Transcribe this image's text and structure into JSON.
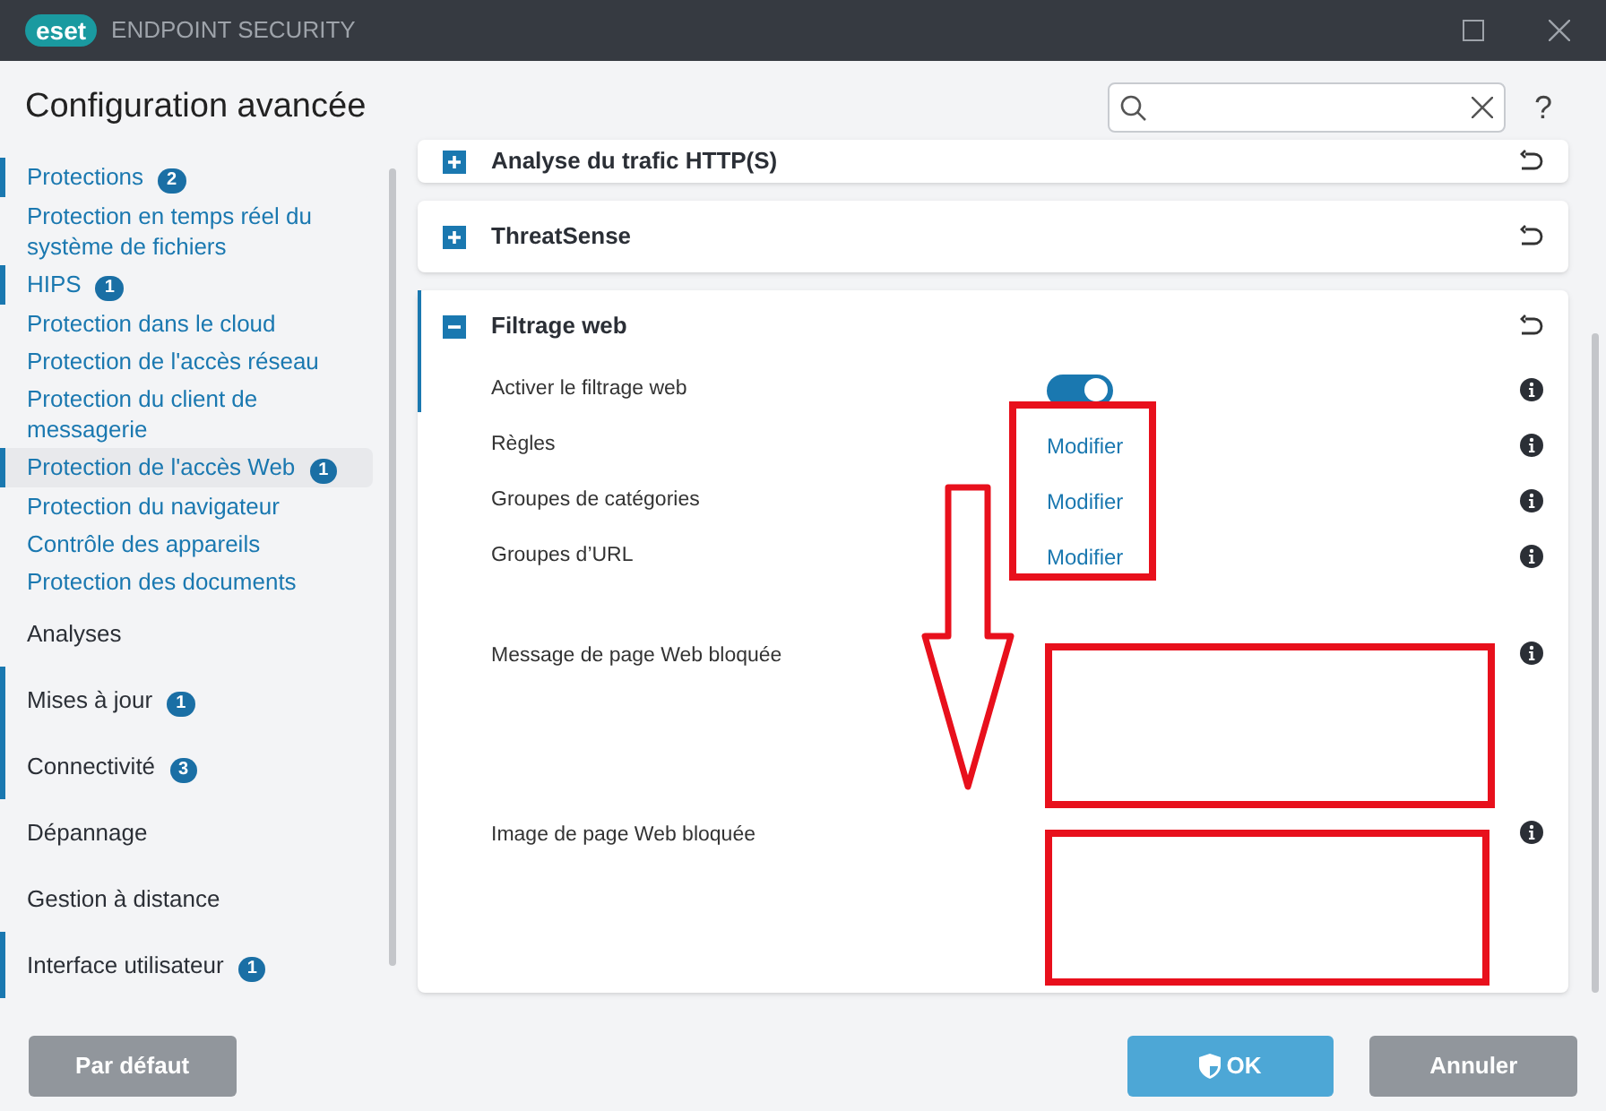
{
  "window": {
    "logo": "eset",
    "title": "ENDPOINT SECURITY"
  },
  "header": {
    "title": "Configuration avancée",
    "help": "?"
  },
  "sidebar": {
    "items": [
      {
        "text": "Protections",
        "badge": "2",
        "kind": "link",
        "marked": true,
        "selected": false
      },
      {
        "text": "Protection en temps réel du système de fichiers",
        "kind": "link",
        "marked": false,
        "selected": false
      },
      {
        "text": "HIPS",
        "badge": "1",
        "kind": "link",
        "marked": true,
        "selected": false
      },
      {
        "text": "Protection dans le cloud",
        "kind": "link",
        "marked": false,
        "selected": false
      },
      {
        "text": "Protection de l'accès réseau",
        "kind": "link",
        "marked": false,
        "selected": false
      },
      {
        "text": "Protection du client de messagerie",
        "kind": "link",
        "marked": false,
        "selected": false
      },
      {
        "text": "Protection de l'accès Web",
        "badge": "1",
        "kind": "link",
        "marked": true,
        "selected": true
      },
      {
        "text": "Protection du navigateur",
        "kind": "link",
        "marked": false,
        "selected": false
      },
      {
        "text": "Contrôle des appareils",
        "kind": "link",
        "marked": false,
        "selected": false
      },
      {
        "text": "Protection des documents",
        "kind": "link",
        "marked": false,
        "selected": false
      },
      {
        "text": "Analyses",
        "kind": "heading",
        "marked": false,
        "selected": false
      },
      {
        "text": "Mises à jour",
        "badge": "1",
        "kind": "heading",
        "marked": true,
        "selected": false
      },
      {
        "text": "Connectivité",
        "badge": "3",
        "kind": "heading",
        "marked": true,
        "selected": false
      },
      {
        "text": "Dépannage",
        "kind": "heading",
        "marked": false,
        "selected": false
      },
      {
        "text": "Gestion à distance",
        "kind": "heading",
        "marked": false,
        "selected": false
      },
      {
        "text": "Interface utilisateur",
        "badge": "1",
        "kind": "heading",
        "marked": true,
        "selected": false
      }
    ]
  },
  "sections": [
    {
      "title": "Analyse du trafic HTTP(S)",
      "expanded": false
    },
    {
      "title": "ThreatSense",
      "expanded": false
    },
    {
      "title": "Filtrage web",
      "expanded": true,
      "rows": [
        {
          "label": "Activer le filtrage web",
          "kind": "toggle",
          "on": true
        },
        {
          "label": "Règles",
          "kind": "link",
          "value": "Modifier"
        },
        {
          "label": "Groupes de catégories",
          "kind": "link",
          "value": "Modifier"
        },
        {
          "label": "Groupes d’URL",
          "kind": "link",
          "value": "Modifier"
        },
        {
          "label": "Message de page Web bloquée",
          "kind": "text"
        },
        {
          "label": "Image de page Web bloquée",
          "kind": "text"
        }
      ]
    }
  ],
  "footer": {
    "buttons": [
      {
        "label": "Par défaut",
        "kind": "secondary"
      },
      {
        "label": "OK",
        "kind": "primary"
      },
      {
        "label": "Annuler",
        "kind": "secondary"
      }
    ]
  }
}
